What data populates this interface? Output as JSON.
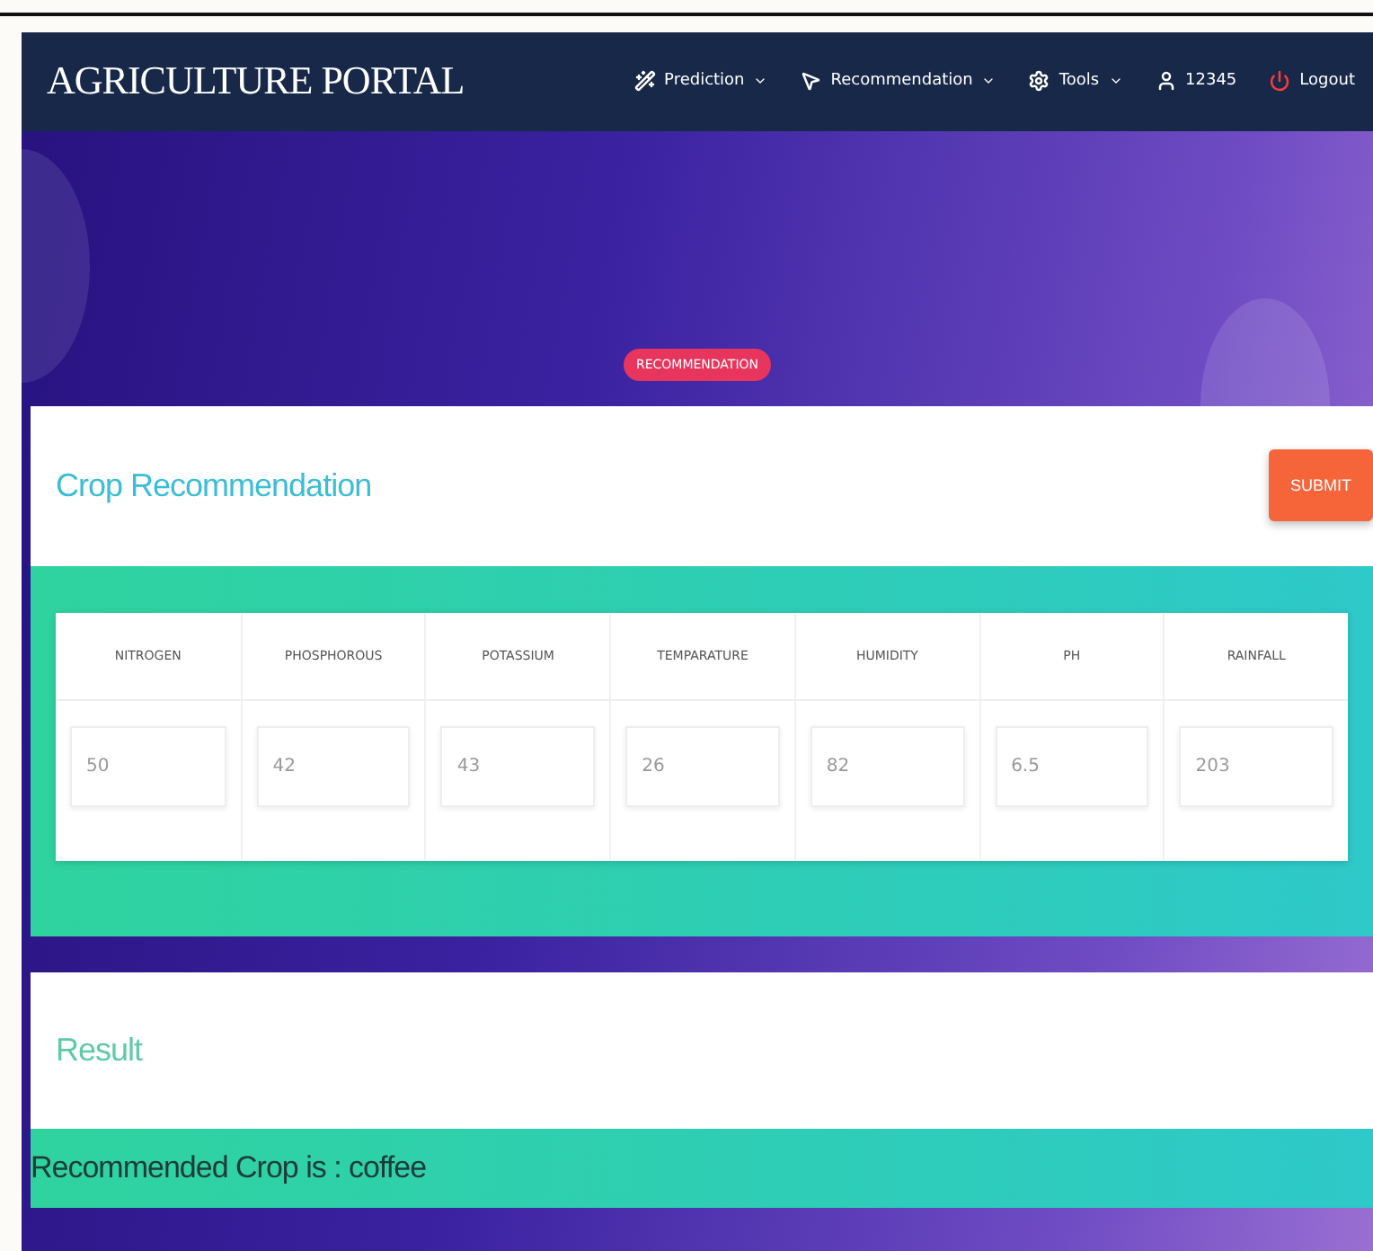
{
  "navbar": {
    "brand": "AGRICULTURE PORTAL",
    "items": [
      {
        "kind": "dropdown",
        "label": "Prediction"
      },
      {
        "kind": "dropdown",
        "label": "Recommendation"
      },
      {
        "kind": "dropdown",
        "label": "Tools"
      },
      {
        "kind": "link",
        "label": "12345"
      },
      {
        "kind": "link",
        "label": "Logout"
      }
    ]
  },
  "hero": {
    "badge": "RECOMMENDATION"
  },
  "form_card": {
    "title": "Crop Recommendation",
    "submit": "SUBMIT",
    "fields": [
      {
        "label": "NITROGEN",
        "value": "50"
      },
      {
        "label": "PHOSPHOROUS",
        "value": "42"
      },
      {
        "label": "POTASSIUM",
        "value": "43"
      },
      {
        "label": "TEMPARATURE",
        "value": "26"
      },
      {
        "label": "HUMIDITY",
        "value": "82"
      },
      {
        "label": "PH",
        "value": "6.5"
      },
      {
        "label": "RAINFALL",
        "value": "203"
      }
    ]
  },
  "result_card": {
    "title": "Result",
    "message": "Recommended Crop is : coffee"
  }
}
